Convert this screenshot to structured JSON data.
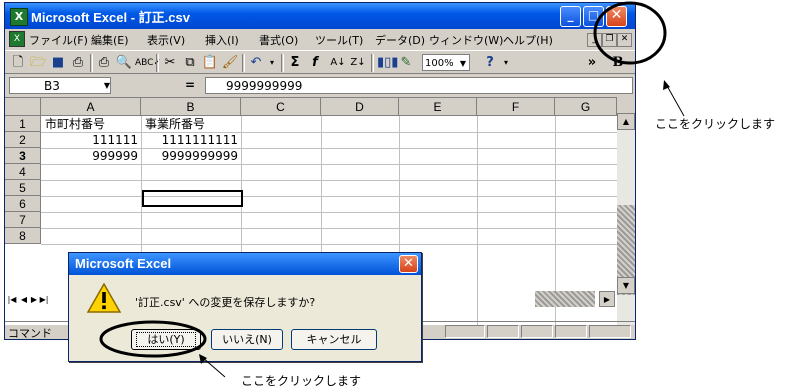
{
  "window": {
    "app_icon": "excel-icon",
    "title": "Microsoft Excel - 訂正.csv",
    "min_label": "_",
    "max_label": "□",
    "close_label": "✕"
  },
  "menubar": {
    "items": [
      "ファイル(F)",
      "編集(E)",
      "表示(V)",
      "挿入(I)",
      "書式(O)",
      "ツール(T)",
      "データ(D)",
      "ウィンドウ(W)",
      "ヘルプ(H)"
    ]
  },
  "toolbar": {
    "zoom": "100%",
    "more": "»",
    "bold": "B"
  },
  "formula": {
    "cell_ref": "B3",
    "eq": "=",
    "content": "9999999999"
  },
  "sheet": {
    "columns": [
      "A",
      "B",
      "C",
      "D",
      "E",
      "F",
      "G"
    ],
    "rows": [
      "1",
      "2",
      "3",
      "4",
      "5",
      "6",
      "7",
      "8"
    ],
    "cells": {
      "a1": "市町村番号",
      "b1": "事業所番号",
      "a2": "111111",
      "b2": "1111111111",
      "a3": "999999",
      "b3": "9999999999"
    }
  },
  "status": {
    "text": "コマンド"
  },
  "dialog": {
    "title": "Microsoft Excel",
    "close": "✕",
    "icon": "warning-icon",
    "message": "'訂正.csv' への変更を保存しますか?",
    "yes": "はい(Y)",
    "no": "いいえ(N)",
    "cancel": "キャンセル"
  },
  "annotations": {
    "close_hint": "ここをクリックします",
    "yes_hint": "ここをクリックします"
  }
}
